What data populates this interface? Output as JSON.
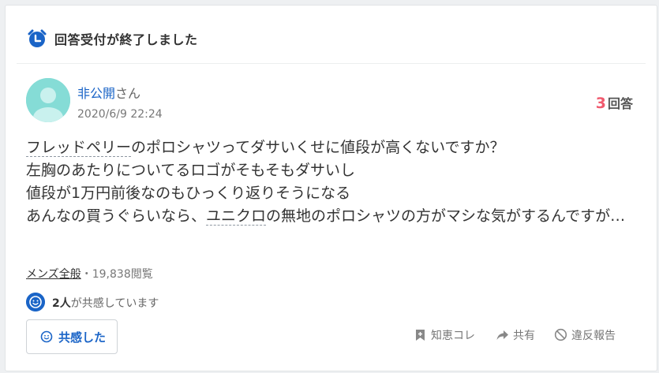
{
  "header": {
    "status_title": "回答受付が終了しました",
    "icon": "alarm-clock-icon"
  },
  "question": {
    "user_name": "非公開",
    "user_suffix": "さん",
    "date": "2020/6/9 22:24",
    "answer_count": "3",
    "answer_label": "回答",
    "body_lines": [
      "フレッドペリーのポロシャツってダサいくせに値段が高くないですか？",
      "左胸のあたりについてるロゴがそもそもダサいし",
      "値段が1万円前後なのもひっくり返りそうになる",
      "あんなの買うぐらいなら、ユニクロの無地のポロシャツの方がマシな気がするんですが…"
    ],
    "body_segments": {
      "line1_a": "フレッドペリー",
      "line1_b": "のポロシャツってダサいくせに値段が高くないですか？",
      "line4_a": "あんなの買うぐらいなら、",
      "line4_b": "ユニクロ",
      "line4_c": "の無地のポロシャツの方がマシな気がするんですが…"
    },
    "category": "メンズ全般",
    "separator": "・",
    "views": "19,838閲覧"
  },
  "empathy": {
    "count_text": "2人",
    "suffix_text": "が共感しています",
    "button_label": "共感した"
  },
  "actions": {
    "save_label": "知恵コレ",
    "share_label": "共有",
    "report_label": "違反報告"
  },
  "colors": {
    "accent_blue": "#1a64c7",
    "answer_count_red": "#f05a6e",
    "avatar_teal": "#85dcd6"
  }
}
